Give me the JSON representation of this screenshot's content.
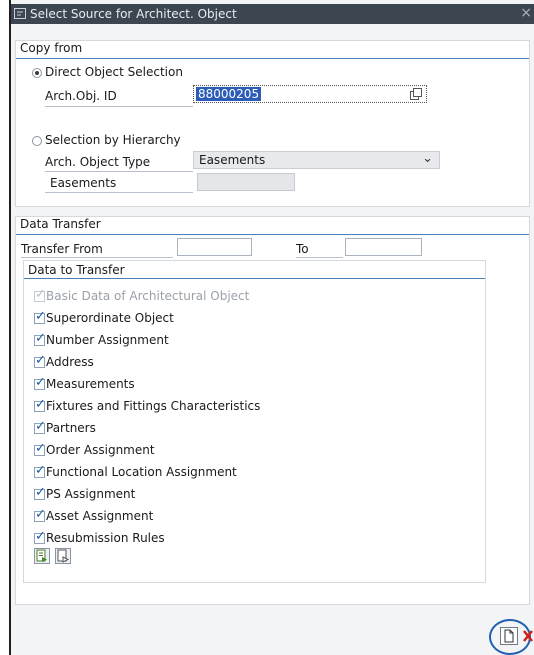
{
  "dialog": {
    "title": "Select Source for Architect. Object",
    "close_glyph": "×"
  },
  "copy_from": {
    "title": "Copy from",
    "direct": {
      "label": "Direct Object Selection",
      "selected": true,
      "field_label": "Arch.Obj. ID",
      "field_value": "88000205"
    },
    "hierarchy": {
      "label": "Selection by Hierarchy",
      "selected": false,
      "type_label": "Arch. Object Type",
      "type_value": "Easements",
      "easements_label": "Easements",
      "easements_value": ""
    }
  },
  "data_transfer": {
    "title": "Data Transfer",
    "from_label": "Transfer From",
    "from_value": "",
    "to_label": "To",
    "to_value": "",
    "subgroup_title": "Data to Transfer",
    "items": [
      {
        "label": "Basic Data of Architectural Object",
        "checked": true,
        "disabled": true
      },
      {
        "label": "Superordinate Object",
        "checked": true,
        "disabled": false
      },
      {
        "label": "Number Assignment",
        "checked": true,
        "disabled": false
      },
      {
        "label": "Address",
        "checked": true,
        "disabled": false
      },
      {
        "label": "Measurements",
        "checked": true,
        "disabled": false
      },
      {
        "label": "Fixtures and Fittings Characteristics",
        "checked": true,
        "disabled": false
      },
      {
        "label": "Partners",
        "checked": true,
        "disabled": false
      },
      {
        "label": "Order Assignment",
        "checked": true,
        "disabled": false
      },
      {
        "label": "Functional Location Assignment",
        "checked": true,
        "disabled": false
      },
      {
        "label": "PS Assignment",
        "checked": true,
        "disabled": false
      },
      {
        "label": "Asset Assignment",
        "checked": true,
        "disabled": false
      },
      {
        "label": "Resubmission Rules",
        "checked": true,
        "disabled": false
      }
    ]
  },
  "icons": {
    "select_all": "select-all-icon",
    "deselect_all": "deselect-all-icon",
    "value_help": "value-help-icon",
    "create": "new-document-icon",
    "cancel": "cancel-icon"
  },
  "colors": {
    "titlebar": "#3c4650",
    "group_line": "#4a7fb5",
    "selection": "#2a5cb8",
    "highlight_circle": "#1f5fb0",
    "cancel_red": "#d02020"
  }
}
